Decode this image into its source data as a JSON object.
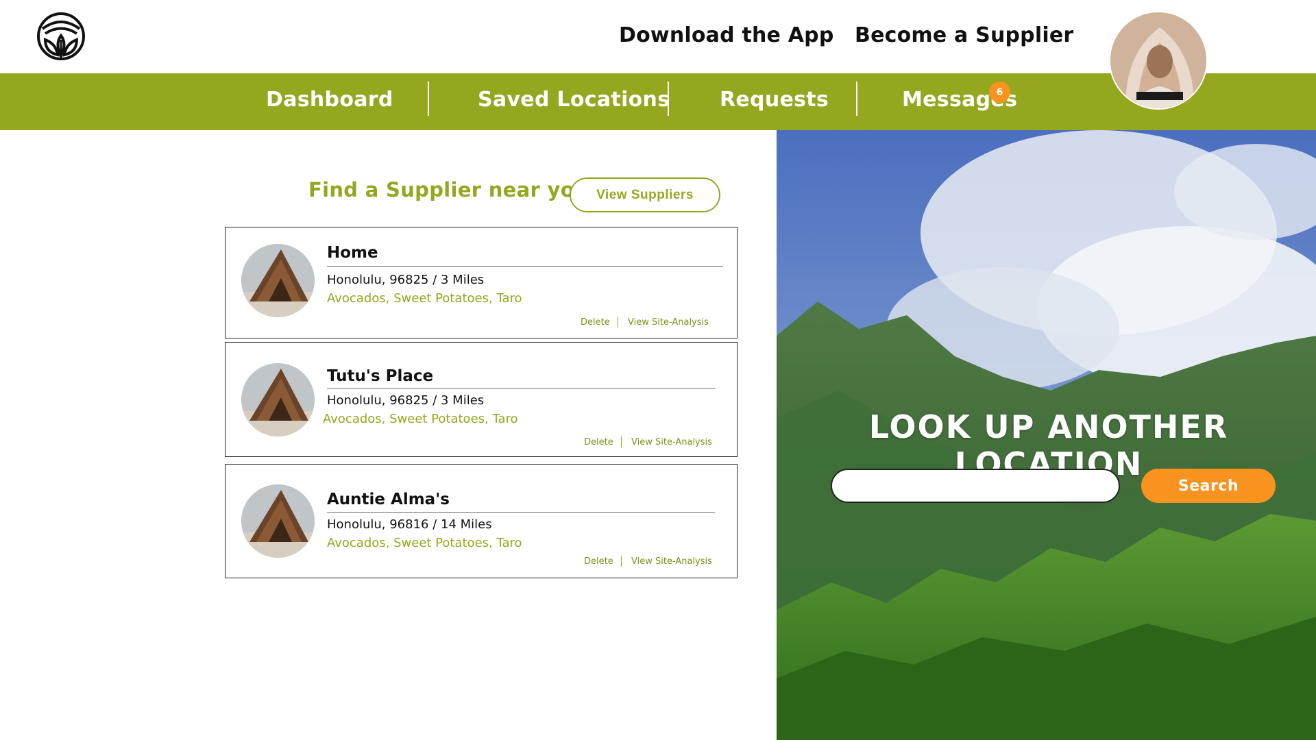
{
  "header": {
    "download_app": "Download the App",
    "become_supplier": "Become a Supplier"
  },
  "nav": {
    "dashboard": "Dashboard",
    "saved_locations": "Saved Locations",
    "requests": "Requests",
    "messages": "Messages",
    "messages_badge": "6"
  },
  "main": {
    "find_title": "Find a Supplier near you.",
    "view_suppliers": "View  Suppliers",
    "locations": [
      {
        "name": "Home",
        "address": "Honolulu, 96825 / 3 Miles",
        "crops": "Avocados, Sweet Potatoes, Taro",
        "delete": "Delete",
        "analysis": "View Site-Analysis"
      },
      {
        "name": "Tutu's Place",
        "address": "Honolulu, 96825 / 3 Miles",
        "crops": "Avocados, Sweet Potatoes, Taro",
        "delete": "Delete",
        "analysis": "View Site-Analysis"
      },
      {
        "name": "Auntie Alma's",
        "address": "Honolulu, 96816 / 14 Miles",
        "crops": "Avocados, Sweet Potatoes, Taro",
        "delete": "Delete",
        "analysis": "View Site-Analysis"
      }
    ]
  },
  "hero": {
    "title": "LOOK UP ANOTHER LOCATION",
    "search_value": "",
    "search_button": "Search"
  },
  "colors": {
    "brand_green": "#94a71f",
    "accent_orange": "#f7931e"
  },
  "icons": {
    "logo": "leaf-logo-icon"
  }
}
